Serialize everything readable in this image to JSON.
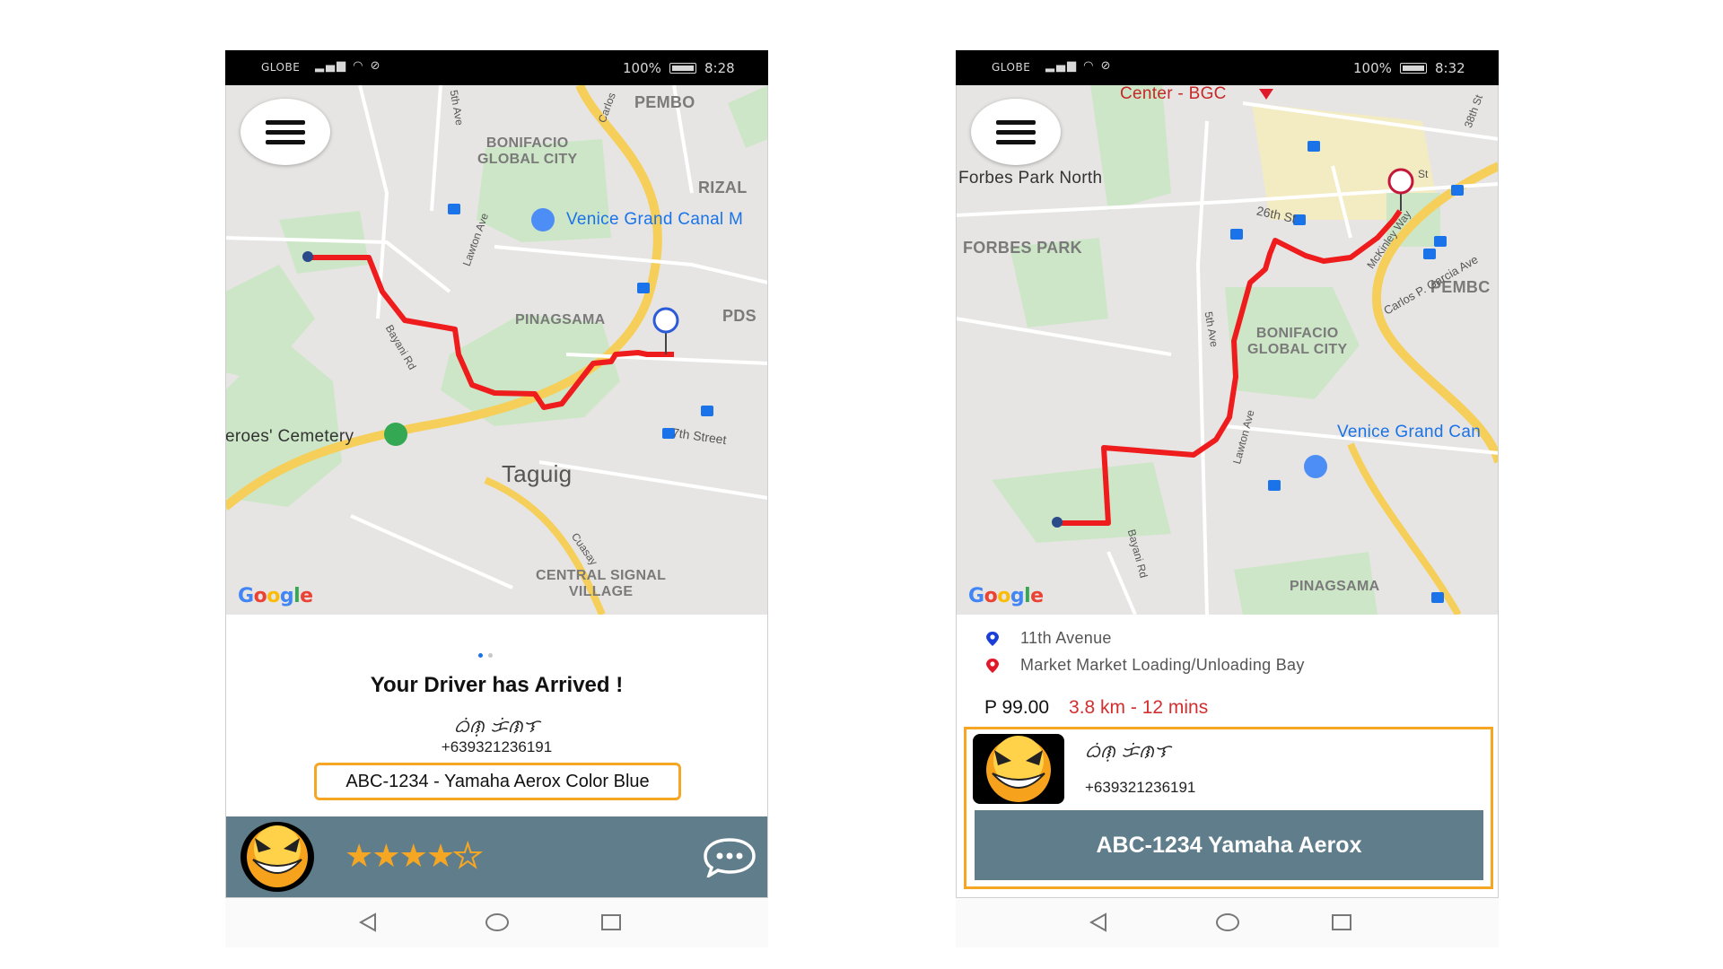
{
  "left_screen": {
    "status": {
      "carrier": "GLOBE",
      "battery": "100%",
      "time": "8:28"
    },
    "map": {
      "labels": {
        "pembo": "PEMBO",
        "bgc": "BONIFACIO\nGLOBAL CITY",
        "rizal": "RIZAL",
        "venice": "Venice Grand Canal M",
        "pinagsama": "PINAGSAMA",
        "pds": "PDS",
        "cemetery": "eroes' Cemetery",
        "taguig": "Taguig",
        "central": "CENTRAL SIGNAL\nVILLAGE",
        "street_7th": "7th Street",
        "street_bayani": "Bayani Rd",
        "street_lawton": "Lawton Ave",
        "street_carlos": "Carlos",
        "street_cuasay": "Cuasay",
        "street_5th": "5th Ave"
      },
      "google": "Google"
    },
    "panel": {
      "title": "Your Driver has Arrived !",
      "driver_name": "ᜊᜒᜈᜓ ᜃᜒᜈᜎ",
      "driver_phone": "+639321236191",
      "vehicle": "ABC-1234 - Yamaha Aerox Color Blue",
      "rating": 4,
      "rating_max": 5
    }
  },
  "right_screen": {
    "status": {
      "carrier": "GLOBE",
      "battery": "100%",
      "time": "8:32"
    },
    "map": {
      "labels": {
        "center_bgc": "Center - BGC",
        "forbes_north": "Forbes Park North",
        "forbes": "FORBES PARK",
        "pembo": "PEMBC",
        "bgc": "BONIFACIO\nGLOBAL CITY",
        "venice": "Venice Grand Can",
        "pinagsama": "PINAGSAMA",
        "street_26th": "26th St",
        "street_5th": "5th Ave",
        "street_lawton": "Lawton Ave",
        "street_bayani": "Bayani Rd",
        "street_carlos": "Carlos P. Garcia Ave",
        "street_mckinley": "McKinley Way",
        "street_38th": "38th St",
        "street_st": "St"
      },
      "google": "Google"
    },
    "panel": {
      "pickup": "11th Avenue",
      "dropoff": "Market Market Loading/Unloading Bay",
      "fare": "P 99.00",
      "eta": "3.8 km - 12 mins",
      "driver_name": "ᜊᜒᜈᜓ ᜃᜒᜈᜎ",
      "driver_phone": "+639321236191",
      "vehicle_button": "ABC-1234 Yamaha Aerox"
    }
  },
  "colors": {
    "route": "#ee1c1c",
    "accent": "#f5a623",
    "bar": "#607d8b",
    "pickup_pin": "#1a3fd6",
    "dropoff_pin": "#e0192b"
  }
}
